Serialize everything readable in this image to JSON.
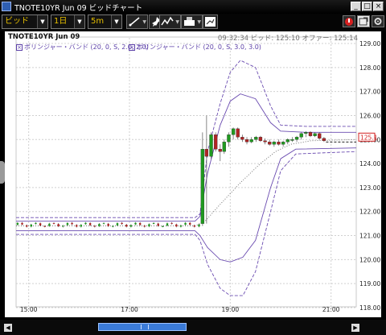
{
  "window": {
    "title": "TNOTE10YR Jun 09 ビッドチャート",
    "buttons": {
      "minimize": "_",
      "maximize": "□",
      "close": "×"
    }
  },
  "toolbar": {
    "price_type": "ビッド",
    "range": "1日",
    "interval": "5m",
    "tools": [
      "draw-line-icon",
      "pin-icon",
      "indicator-icon",
      "print-icon",
      "image-export-icon"
    ],
    "right_tools": [
      "alert-icon",
      "popout-icon",
      "settings-icon"
    ]
  },
  "chart_header": {
    "instrument": "TNOTE10YR Jun 09",
    "time": "09:32:34",
    "bid_label": "ビッド",
    "bid_value": "125:10",
    "offer_label": "オファー",
    "offer_value": "125:14"
  },
  "indicators": [
    {
      "label": "ボリンジャー・バンド (20, 0, S, 2.0, 2.0)",
      "color": "#5b3fa8"
    },
    {
      "label": "ボリンジャー・バンド (20, 0, S, 3.0, 3.0)",
      "color": "#5b3fa8"
    }
  ],
  "chart_data": {
    "type": "candlestick",
    "y_range": [
      118.0,
      129.0
    ],
    "y_ticks": [
      "118.00",
      "119.00",
      "120.00",
      "121.00",
      "122.00",
      "123.00",
      "124.00",
      "125.00",
      "126.00",
      "127.00",
      "128.00",
      "129.00"
    ],
    "x_range_hours": [
      14.75,
      21.5
    ],
    "x_ticks": [
      "15:00",
      "17:00",
      "19:00",
      "21:00"
    ],
    "x_tick_hours": [
      15,
      17,
      19,
      21
    ],
    "current_price_label": "125.1",
    "current_price": 125.1,
    "colors": {
      "up": "#1f9a1f",
      "down": "#b02424",
      "band": "#6a4bb0",
      "ma": "#666666",
      "price_tag": "#d32020"
    },
    "candles": [
      {
        "t": 18.45,
        "o": 121.5,
        "h": 125.3,
        "l": 121.4,
        "c": 124.6
      },
      {
        "t": 18.53,
        "o": 124.6,
        "h": 126.0,
        "l": 121.5,
        "c": 124.3
      },
      {
        "t": 18.62,
        "o": 124.3,
        "h": 125.3,
        "l": 124.2,
        "c": 125.2
      },
      {
        "t": 18.71,
        "o": 125.2,
        "h": 125.3,
        "l": 124.5,
        "c": 124.6
      },
      {
        "t": 18.8,
        "o": 124.6,
        "h": 124.8,
        "l": 124.1,
        "c": 124.5
      },
      {
        "t": 18.88,
        "o": 124.5,
        "h": 125.0,
        "l": 124.4,
        "c": 124.9
      },
      {
        "t": 18.97,
        "o": 124.9,
        "h": 125.3,
        "l": 124.7,
        "c": 125.2
      },
      {
        "t": 19.06,
        "o": 125.2,
        "h": 125.5,
        "l": 125.0,
        "c": 125.45
      },
      {
        "t": 19.15,
        "o": 125.45,
        "h": 125.5,
        "l": 125.0,
        "c": 125.1
      },
      {
        "t": 19.24,
        "o": 125.1,
        "h": 125.2,
        "l": 124.9,
        "c": 125.0
      },
      {
        "t": 19.33,
        "o": 125.0,
        "h": 125.1,
        "l": 124.8,
        "c": 124.9
      },
      {
        "t": 19.42,
        "o": 124.9,
        "h": 125.1,
        "l": 124.85,
        "c": 125.0
      },
      {
        "t": 19.51,
        "o": 125.0,
        "h": 125.15,
        "l": 124.9,
        "c": 125.1
      },
      {
        "t": 19.6,
        "o": 125.1,
        "h": 125.15,
        "l": 124.9,
        "c": 124.95
      },
      {
        "t": 19.69,
        "o": 124.95,
        "h": 125.05,
        "l": 124.8,
        "c": 124.9
      },
      {
        "t": 19.78,
        "o": 124.9,
        "h": 125.0,
        "l": 124.75,
        "c": 124.8
      },
      {
        "t": 19.87,
        "o": 124.8,
        "h": 124.95,
        "l": 124.7,
        "c": 124.9
      },
      {
        "t": 19.96,
        "o": 124.9,
        "h": 125.0,
        "l": 124.75,
        "c": 124.8
      },
      {
        "t": 20.05,
        "o": 124.8,
        "h": 124.95,
        "l": 124.7,
        "c": 124.9
      },
      {
        "t": 20.14,
        "o": 124.9,
        "h": 125.05,
        "l": 124.8,
        "c": 125.0
      },
      {
        "t": 20.23,
        "o": 125.0,
        "h": 125.1,
        "l": 124.9,
        "c": 125.0
      },
      {
        "t": 20.32,
        "o": 125.0,
        "h": 125.15,
        "l": 124.9,
        "c": 125.1
      },
      {
        "t": 20.41,
        "o": 125.1,
        "h": 125.3,
        "l": 125.0,
        "c": 125.25
      },
      {
        "t": 20.5,
        "o": 125.25,
        "h": 125.35,
        "l": 125.1,
        "c": 125.3
      },
      {
        "t": 20.59,
        "o": 125.3,
        "h": 125.35,
        "l": 125.1,
        "c": 125.15
      },
      {
        "t": 20.68,
        "o": 125.15,
        "h": 125.3,
        "l": 125.1,
        "c": 125.25
      },
      {
        "t": 20.77,
        "o": 125.25,
        "h": 125.3,
        "l": 125.0,
        "c": 125.05
      },
      {
        "t": 20.86,
        "o": 125.05,
        "h": 125.1,
        "l": 124.9,
        "c": 124.95
      }
    ],
    "flat_series": {
      "t_start": 14.78,
      "t_end": 18.38,
      "step": 0.09,
      "base": 121.45,
      "amp": 0.08
    },
    "bands": [
      {
        "name": "upper_3",
        "style": "dashed",
        "points": [
          [
            14.75,
            121.75
          ],
          [
            18.3,
            121.75
          ],
          [
            18.4,
            121.9
          ],
          [
            18.55,
            124.5
          ],
          [
            18.8,
            126.5
          ],
          [
            19.0,
            127.8
          ],
          [
            19.2,
            128.3
          ],
          [
            19.5,
            128.0
          ],
          [
            19.8,
            126.4
          ],
          [
            20.0,
            125.6
          ],
          [
            20.5,
            125.55
          ],
          [
            21.5,
            125.55
          ]
        ]
      },
      {
        "name": "upper_2",
        "style": "solid",
        "points": [
          [
            14.75,
            121.6
          ],
          [
            18.3,
            121.6
          ],
          [
            18.4,
            121.8
          ],
          [
            18.55,
            123.6
          ],
          [
            18.8,
            125.6
          ],
          [
            19.0,
            126.6
          ],
          [
            19.2,
            126.9
          ],
          [
            19.5,
            126.7
          ],
          [
            19.8,
            125.7
          ],
          [
            20.0,
            125.35
          ],
          [
            20.5,
            125.3
          ],
          [
            21.5,
            125.3
          ]
        ]
      },
      {
        "name": "ma",
        "style": "dotted",
        "points": [
          [
            14.75,
            121.4
          ],
          [
            18.3,
            121.4
          ],
          [
            18.5,
            121.6
          ],
          [
            18.8,
            122.3
          ],
          [
            19.2,
            123.2
          ],
          [
            19.6,
            124.0
          ],
          [
            19.9,
            124.5
          ],
          [
            20.2,
            124.8
          ],
          [
            20.6,
            124.95
          ],
          [
            21.5,
            125.0
          ]
        ]
      },
      {
        "name": "lower_2",
        "style": "solid",
        "points": [
          [
            14.75,
            121.2
          ],
          [
            18.3,
            121.2
          ],
          [
            18.4,
            121.0
          ],
          [
            18.55,
            120.5
          ],
          [
            18.8,
            120.0
          ],
          [
            19.0,
            119.9
          ],
          [
            19.25,
            120.1
          ],
          [
            19.5,
            120.8
          ],
          [
            19.8,
            123.0
          ],
          [
            20.0,
            124.2
          ],
          [
            20.3,
            124.6
          ],
          [
            21.5,
            124.65
          ]
        ]
      },
      {
        "name": "lower_3",
        "style": "dashed",
        "points": [
          [
            14.75,
            121.05
          ],
          [
            18.3,
            121.05
          ],
          [
            18.4,
            120.8
          ],
          [
            18.55,
            119.8
          ],
          [
            18.8,
            118.8
          ],
          [
            19.0,
            118.5
          ],
          [
            19.25,
            118.5
          ],
          [
            19.5,
            119.5
          ],
          [
            19.8,
            122.0
          ],
          [
            20.0,
            123.7
          ],
          [
            20.3,
            124.4
          ],
          [
            21.5,
            124.5
          ]
        ]
      },
      {
        "name": "last_price",
        "style": "dashed-black",
        "points": [
          [
            20.9,
            124.9
          ],
          [
            21.5,
            124.9
          ]
        ]
      }
    ]
  },
  "scrollbar": {
    "left_arrow": "◀",
    "right_arrow": "▶",
    "position": 0.27
  }
}
